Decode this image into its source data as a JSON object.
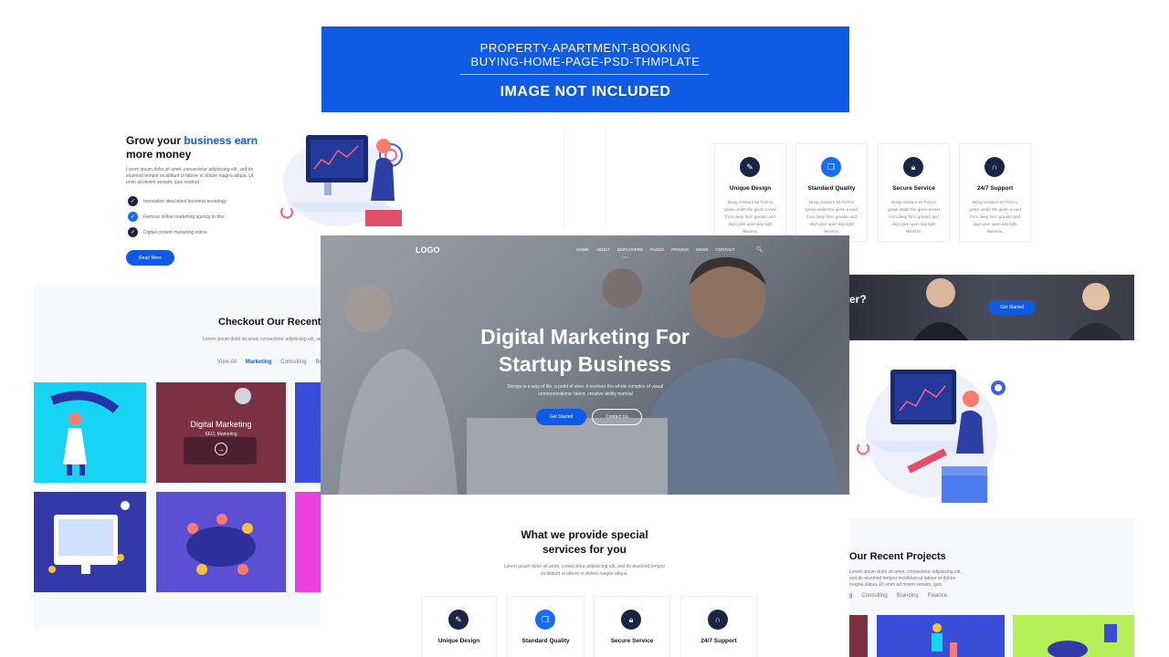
{
  "banner": {
    "line1": "PROPERTY-APARTMENT-BOOKING",
    "line2": "BUYING-HOME-PAGE-PSD-THMPLATE",
    "line3": "IMAGE NOT INCLUDED"
  },
  "grow": {
    "title_part1": "Grow your ",
    "title_highlight": "business earn",
    "title_part2": "more money",
    "description": "Lorem ipsum dolor sit amet, consectetur adipisicing elit, sed do eiusmod tempor incididunt ut labore et dolore magna aliqua. Ut enim ad minim veniam, quis nostrud",
    "checks": [
      "Innovation idea latest business tecnology",
      "Famous online marketing agency in this",
      "Digital content marketing online"
    ],
    "read_more": "Read More"
  },
  "services": [
    {
      "icon": "edit-icon",
      "title": "Unique Design",
      "text": "Bring creature let Fish to grass under the given a void from deep form greater and days give upon day light likeness."
    },
    {
      "icon": "copy-icon",
      "title": "Standard Quality",
      "text": "Bring creature let Fish to grass under the given a void from deep form greater and days give upon day light likeness."
    },
    {
      "icon": "lock-icon",
      "title": "Secure Service",
      "text": "Bring creature let Fish to grass under the given a void from deep form greater and days give upon day light likeness."
    },
    {
      "icon": "headset-icon",
      "title": "24/7 Support",
      "text": "Bring creature let Fish to grass under the given a void from deep form greater and days give upon day light likeness."
    }
  ],
  "strip": {
    "text": "er?",
    "button": "Get Started"
  },
  "left": {
    "title": "Checkout Our Recent",
    "description": "Lorem ipsum dolor sit amet, consectetur adipisicing elit, sed do eiusmod tempor incididunt ut labore et dolore magna aliqua. Ut enim ad minim veniam",
    "filters": [
      "View All",
      "Marketing",
      "Consulting",
      "Br"
    ],
    "tile_title": "Digital Marketing",
    "tile_sub": "SEO, Marketing"
  },
  "hero": {
    "logo": "LOGO",
    "nav": [
      "HOME",
      "ABOUT",
      "EMPLOYERS",
      "PAGES",
      "PRICING",
      "NEWS",
      "CONTACT"
    ],
    "nav_dots": "• • •",
    "headline1": "Digital Marketing For",
    "headline2": "Startup Business",
    "sub1": "Design is a way of life, a point of view. It involves the whole complex of visual",
    "sub2": "communications: talent, creative ability manual",
    "btn_primary": "Get Started",
    "btn_secondary": "Contact Us"
  },
  "what": {
    "title1": "What we provide special",
    "title2": "services for you",
    "description": "Lorem ipsum dolor sit amet, consectetur adipisicing elit, sed do eiusmod tempor incididunt ut labore et dolore magna aliqua."
  },
  "right": {
    "title": "Our Recent Projects",
    "description": "Lorem ipsum dolor sit amet, consectetur adipisicing elit, sed do eiusmod tempor incididunt ut labore et dolore magna aliqua. Ut enim ad minim veniam, quis",
    "filters": [
      "g",
      "Consulting",
      "Branding",
      "Finance"
    ]
  },
  "colors": {
    "accent": "#0f5be3",
    "navy": "#1a2544",
    "panel": "#f6f9fc"
  }
}
